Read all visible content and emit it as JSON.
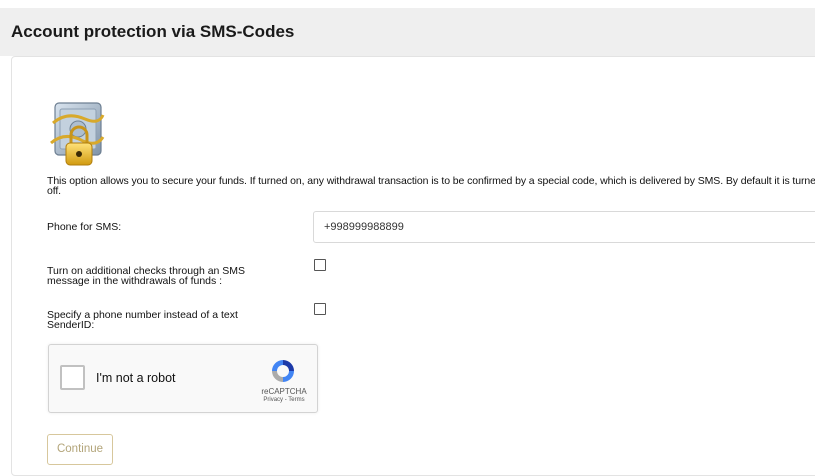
{
  "header": {
    "title": "Account protection via SMS-Codes"
  },
  "security": {
    "icon": "safe-with-chain-lock-icon",
    "description": "This option allows you to secure your funds. If turned on, any withdrawal transaction is to be confirmed by a special code, which is delivered by SMS. By default it is turned off."
  },
  "form": {
    "phone_label": "Phone for SMS:",
    "phone_value": "+998999988899",
    "additional_checks_label": "Turn on additional checks through an SMS message in the withdrawals of funds :",
    "additional_checks_checked": false,
    "phone_sender_label": "Specify a phone number instead of a text SenderID:",
    "phone_sender_checked": false
  },
  "captcha": {
    "label": "I'm not a robot",
    "brand": "reCAPTCHA",
    "links": "Privacy - Terms",
    "icon": "recaptcha-logo-icon"
  },
  "actions": {
    "continue_label": "Continue"
  },
  "colors": {
    "header_bg": "#efefef",
    "button_border": "#d7c79c",
    "button_text": "#b3a57a"
  }
}
